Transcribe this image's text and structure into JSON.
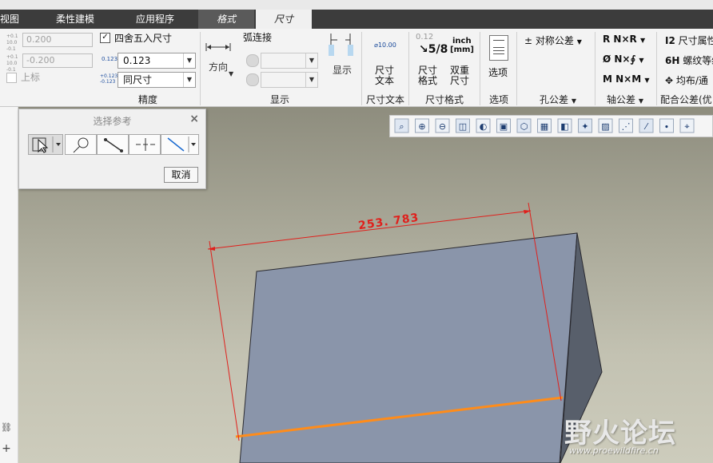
{
  "window": {
    "title_fragment": ""
  },
  "tabs": [
    {
      "label": "视图"
    },
    {
      "label": "柔性建模"
    },
    {
      "label": "应用程序"
    },
    {
      "label": "格式"
    },
    {
      "label": "尺寸"
    }
  ],
  "precision": {
    "upper_tol_icon": "+0.1/10.0/-0.1",
    "upper_value": "0.200",
    "lower_value": "-0.200",
    "upper_label": "上标",
    "round_label": "四舍五入尺寸",
    "round_checked": true,
    "decimal_icon": "0.123",
    "decimal_value": "0.123",
    "tol_icon": "+0.123/-0.123",
    "tol_value": "同尺寸",
    "group_label": "精度"
  },
  "display": {
    "direction_label": "方向",
    "arc_label": "弧连接",
    "show_label": "显示",
    "group_label": "显示"
  },
  "dim_text": {
    "icon_text": "⌀10.00",
    "label": "尺寸\n文本",
    "group_label": "尺寸文本"
  },
  "dim_format": {
    "fraction_top": "0.12",
    "fraction": "5/8",
    "inch_label": "inch",
    "mm_label": "[mm]",
    "format_label": "尺寸\n格式",
    "dual_label": "双重\n尺寸",
    "group_label": "尺寸格式"
  },
  "options": {
    "label": "选项",
    "group_label": "选项"
  },
  "hole_tol": {
    "label": "对称公差",
    "group_label": "孔公差"
  },
  "shaft_tol": {
    "items": [
      "R  N×R",
      "Ø  N×∮",
      "M  N×M"
    ],
    "group_label": "轴公差"
  },
  "fit_tol": {
    "items": [
      "尺寸属性",
      "螺纹等级",
      "均布/通"
    ],
    "prefixes": [
      "I2",
      "6H",
      "✥"
    ],
    "group_label": "配合公差(优"
  },
  "select_dialog": {
    "title": "选择参考",
    "close": "×",
    "cancel_label": "取消"
  },
  "view_toolbar": {
    "icons": [
      "zoom-box-icon",
      "zoom-in-icon",
      "zoom-out-icon",
      "refit-icon",
      "shading-icon",
      "box-view-icon",
      "saved-views-icon",
      "camera-icon",
      "spin-center-icon",
      "annotation-icon",
      "section-icon",
      "datum-display-icon",
      "datum-axis-icon",
      "datum-point-icon",
      "csys-icon"
    ]
  },
  "dimension": {
    "value": "253. 783"
  },
  "watermark": {
    "text": "野火论坛",
    "url": "www.proewildfire.cn"
  },
  "colors": {
    "dim_red": "#e0201c",
    "edge_orange": "#ff8c1a",
    "model_face": "#8a95aa"
  }
}
